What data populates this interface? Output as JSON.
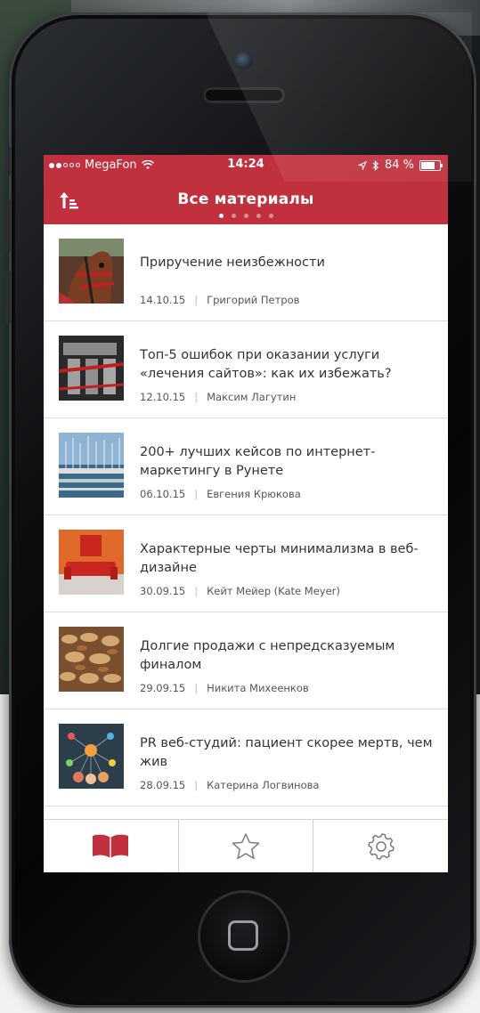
{
  "status_bar": {
    "carrier": "MegaFon",
    "time": "14:24",
    "battery_text": "84 %",
    "battery_level": 0.84,
    "signal_bars_filled": 2,
    "signal_bars_total": 5
  },
  "nav": {
    "title": "Все материалы",
    "page_count": 5,
    "active_page": 1,
    "sort_icon": "sort-up-icon"
  },
  "articles": [
    {
      "title": "Приручение неизбежности",
      "date": "14.10.15",
      "author": "Григорий Петров",
      "thumb": "horse-photo"
    },
    {
      "title": "Топ-5 ошибок при оказании услуги «лечения сайтов»: как их избежать?",
      "date": "12.10.15",
      "author": "Максим Лагутин",
      "thumb": "engine-photo"
    },
    {
      "title": "200+ лучших кейсов по интернет-маркетингу в Рунете",
      "date": "06.10.15",
      "author": "Евгения Крюкова",
      "thumb": "harbor-photo"
    },
    {
      "title": "Характерные черты минимализма в веб-дизайне",
      "date": "30.09.15",
      "author": "Кейт Мейер (Kate Meyer)",
      "thumb": "red-sofa-photo"
    },
    {
      "title": "Долгие продажи с непредсказуемым финалом",
      "date": "29.09.15",
      "author": "Никита Михеенков",
      "thumb": "market-photo"
    },
    {
      "title": "PR веб-студий: пациент скорее мертв, чем жив",
      "date": "28.09.15",
      "author": "Катерина Логвинова",
      "thumb": "network-illustration"
    }
  ],
  "tabs": [
    {
      "icon": "book-icon",
      "active": true
    },
    {
      "icon": "star-icon",
      "active": false
    },
    {
      "icon": "gear-icon",
      "active": false
    }
  ],
  "colors": {
    "accent": "#c0303d",
    "text": "#333333",
    "meta": "#555555",
    "divider": "#dcdcdc",
    "icon_inactive": "#7a7a7a"
  }
}
